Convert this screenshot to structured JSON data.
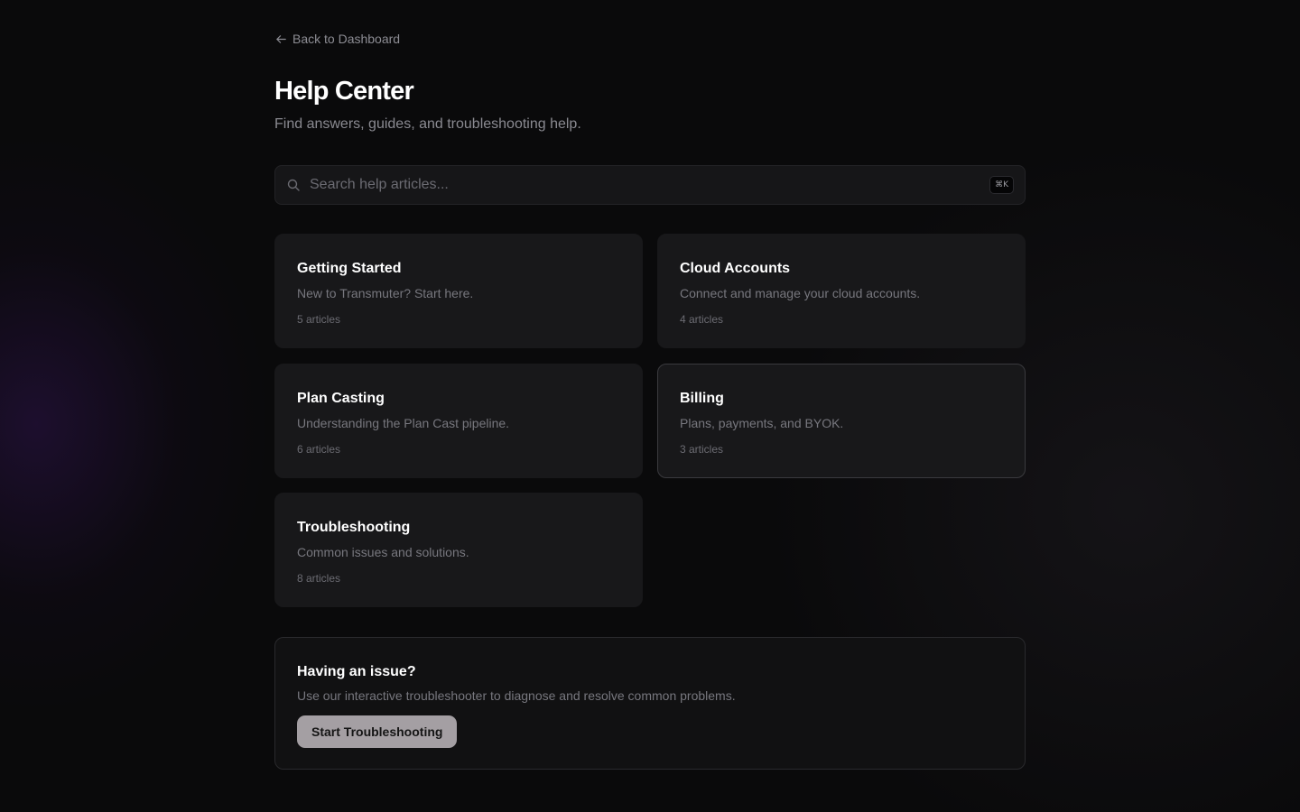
{
  "nav": {
    "back_label": "Back to Dashboard"
  },
  "header": {
    "title": "Help Center",
    "subtitle": "Find answers, guides, and troubleshooting help."
  },
  "search": {
    "placeholder": "Search help articles...",
    "shortcut": "⌘K"
  },
  "categories": [
    {
      "title": "Getting Started",
      "description": "New to Transmuter? Start here.",
      "count": "5 articles"
    },
    {
      "title": "Cloud Accounts",
      "description": "Connect and manage your cloud accounts.",
      "count": "4 articles"
    },
    {
      "title": "Plan Casting",
      "description": "Understanding the Plan Cast pipeline.",
      "count": "6 articles"
    },
    {
      "title": "Billing",
      "description": "Plans, payments, and BYOK.",
      "count": "3 articles"
    },
    {
      "title": "Troubleshooting",
      "description": "Common issues and solutions.",
      "count": "8 articles"
    }
  ],
  "issue": {
    "title": "Having an issue?",
    "description": "Use our interactive troubleshooter to diagnose and resolve common problems.",
    "button_label": "Start Troubleshooting"
  }
}
